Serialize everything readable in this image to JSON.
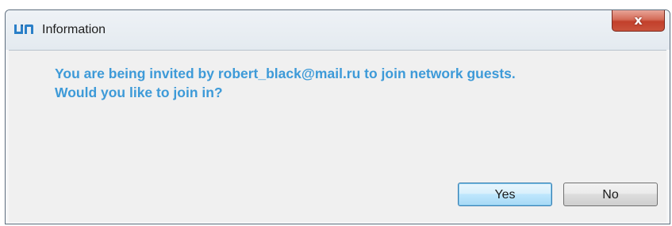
{
  "dialog": {
    "title": "Information",
    "close_label": "x",
    "message_lines": [
      "You are being invited by robert_black@mail.ru to join network guests.",
      "Would you like to join in?"
    ],
    "buttons": {
      "yes_label": "Yes",
      "no_label": "No"
    }
  },
  "colors": {
    "message_text": "#3d9ad8",
    "close_button": "#c9523c",
    "default_button_border": "#3c7fb1",
    "app_icon": "#2a7fc8"
  },
  "icons": {
    "app_icon": "app-logo-icon"
  }
}
